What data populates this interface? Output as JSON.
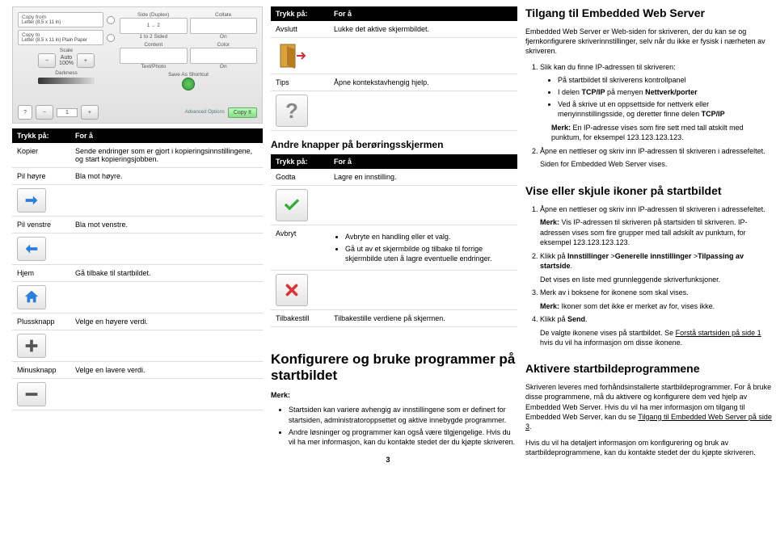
{
  "panel": {
    "copy_from_label": "Copy from",
    "copy_from_value": "Letter (8.5 x 11 in)",
    "copy_to_label": "Copy to",
    "copy_to_value": "Letter (8.5 x 11 in) Plain Paper",
    "scale_label": "Scale",
    "scale_auto": "Auto",
    "scale_value": "100%",
    "darkness_label": "Darkness",
    "side_label": "Side (Duplex)",
    "side_value": "1 to 2 Sided",
    "collate_label": "Collate",
    "collate_value": "On",
    "content_label": "Content",
    "content_value": "Text/Photo",
    "color_label": "Color",
    "color_value": "On",
    "save_shortcut": "Save As Shortcut",
    "advanced": "Advanced Options",
    "copy_it": "Copy It",
    "count": "1"
  },
  "tab1": {
    "head_a": "Trykk på:",
    "head_b": "For å",
    "rows": {
      "kopier": {
        "label": "Kopier",
        "desc": "Sende endringer som er gjort i kopieringsinnstillingene, og start kopieringsjobben."
      },
      "pil_hoyre": {
        "label": "Pil høyre",
        "desc": "Bla mot høyre."
      },
      "pil_venstre": {
        "label": "Pil venstre",
        "desc": "Bla mot venstre."
      },
      "hjem": {
        "label": "Hjem",
        "desc": "Gå tilbake til startbildet."
      },
      "pluss": {
        "label": "Plussknapp",
        "desc": "Velge en høyere verdi."
      },
      "minus": {
        "label": "Minusknapp",
        "desc": "Velge en lavere verdi."
      }
    }
  },
  "tab2": {
    "head_a": "Trykk på:",
    "head_b": "For å",
    "rows": {
      "avslutt": {
        "label": "Avslutt",
        "desc": "Lukke det aktive skjermbildet."
      },
      "tips": {
        "label": "Tips",
        "desc": "Åpne kontekstavhengig hjelp."
      }
    }
  },
  "andre_h": "Andre knapper på berøringsskjermen",
  "tab3": {
    "head_a": "Trykk på:",
    "head_b": "For å",
    "rows": {
      "godta": {
        "label": "Godta",
        "desc": "Lagre en innstilling."
      },
      "avbryt": {
        "label": "Avbryt",
        "desc1": "Avbryte en handling eller et valg.",
        "desc2": "Gå ut av et skjermbilde og tilbake til forrige skjermbilde uten å lagre eventuelle endringer."
      },
      "tilbakestill": {
        "label": "Tilbakestill",
        "desc": "Tilbakestille verdiene på skjermen."
      }
    }
  },
  "konfig_h": "Konfigurere og bruke programmer på startbildet",
  "merk_label": "Merk:",
  "konfig_b1": "Startsiden kan variere avhengig av innstillingene som er definert for startsiden, administratoroppsettet og aktive innebygde programmer.",
  "konfig_b2": "Andre løsninger og programmer kan også være tilgjengelige. Hvis du vil ha mer informasjon, kan du kontakte stedet der du kjøpte skriveren.",
  "col3": {
    "h1": "Tilgang til Embedded Web Server",
    "p1": "Embedded Web Server er Web-siden for skriveren, der du kan se og fjernkonfigurere skriverinnstillinger, selv når du ikke er fysisk i nærheten av skriveren.",
    "step1": "Slik kan du finne IP-adressen til skriveren:",
    "step1_b1": "På startbildet til skriverens kontrollpanel",
    "step1_b2": "I delen TCP/IP på menyen Nettverk/porter",
    "step1_b3": "Ved å skrive ut en oppsettside for nettverk eller menyinnstillingsside, og deretter finne delen TCP/IP",
    "note1": "En IP-adresse vises som fire sett med tall atskilt med punktum, for eksempel 123.123.123.123.",
    "step2": "Åpne en nettleser og skriv inn IP-adressen til skriveren i adressefeltet.",
    "step2_after": "Siden for Embedded Web Server vises.",
    "h2": "Vise eller skjule ikoner på startbildet",
    "h2_s1": "Åpne en nettleser og skriv inn IP-adressen til skriveren i adressefeltet.",
    "h2_note1": "Vis IP-adressen til skriveren på startsiden til skriveren. IP-adressen vises som fire grupper med tall adskilt av punktum, for eksempel 123.123.123.123.",
    "h2_s2": "Klikk på Innstillinger >Generelle innstillinger >Tilpassing av startside.",
    "h2_s2_after": "Det vises en liste med grunnleggende skriverfunksjoner.",
    "h2_s3": "Merk av i boksene for ikonene som skal vises.",
    "h2_s3_note": "Ikoner som det ikke er merket av for, vises ikke.",
    "h2_s4": "Klikk på Send.",
    "h2_s4_after1": "De valgte ikonene vises på startbildet. Se ",
    "h2_s4_link": "Forstå startsiden på side 1",
    "h2_s4_after2": " hvis du vil ha informasjon om disse ikonene.",
    "h3": "Aktivere startbildeprogrammene",
    "h3_p1a": "Skriveren leveres med forhåndsinstallerte startbildeprogrammer. For å bruke disse programmene, må du aktivere og konfigurere dem ved hjelp av Embedded Web Server. Hvis du vil ha mer informasjon om tilgang til Embedded Web Server, kan du se ",
    "h3_link": "Tilgang til Embedded Web Server på side 3",
    "h3_p1b": ".",
    "h3_p2": "Hvis du vil ha detaljert informasjon om konfigurering og bruk av startbildeprogrammene, kan du kontakte stedet der du kjøpte skriveren."
  },
  "page_number": "3"
}
